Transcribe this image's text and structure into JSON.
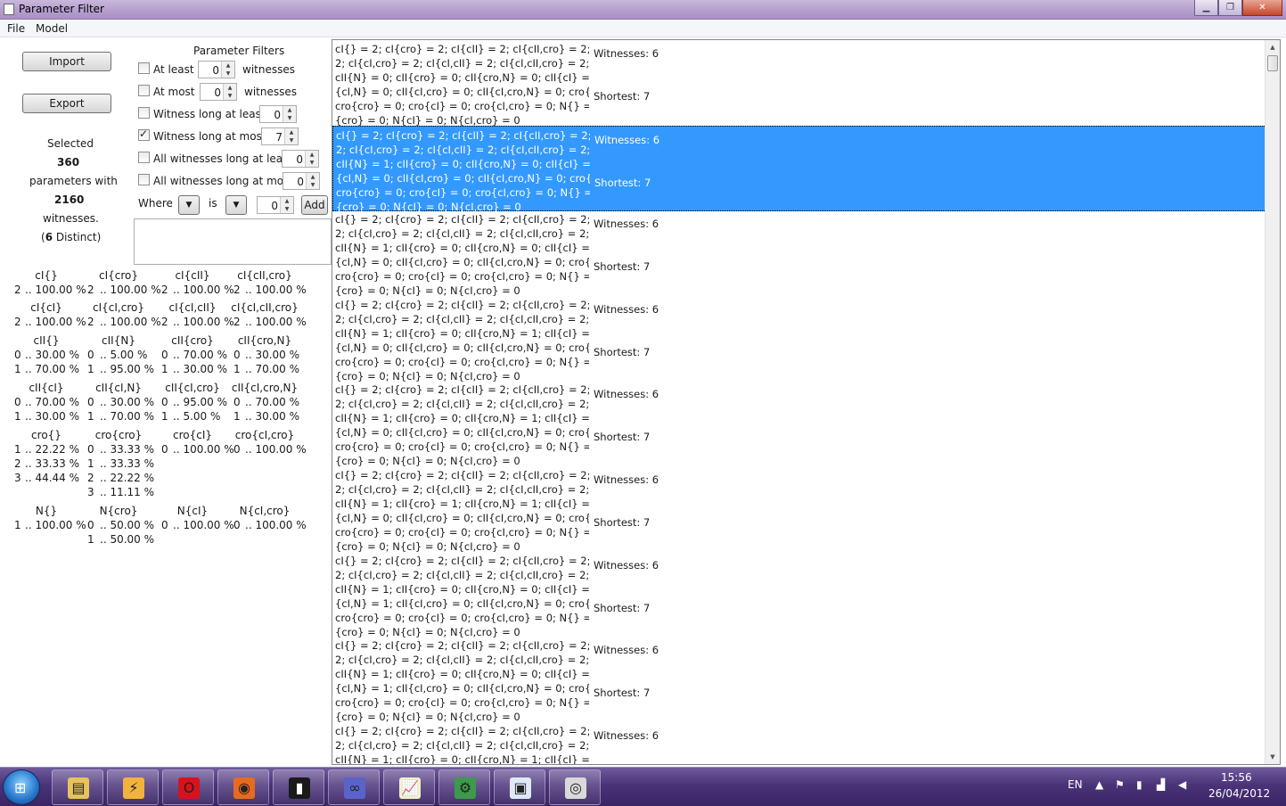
{
  "window": {
    "title": "Parameter Filter"
  },
  "menu": {
    "file": "File",
    "model": "Model"
  },
  "buttons": {
    "import": "Import",
    "export": "Export",
    "add": "Add"
  },
  "filters": {
    "heading": "Parameter Filters",
    "at_least": "At least",
    "at_least_value": "0",
    "at_least_suffix": "witnesses",
    "at_most": "At most",
    "at_most_value": "0",
    "at_most_suffix": "witnesses",
    "witness_long_at_least": "Witness long at least",
    "witness_long_at_least_value": "0",
    "witness_long_at_most": "Witness long at most",
    "witness_long_at_most_value": "7",
    "all_witnesses_long_at_least": "All witnesses long at least",
    "all_witnesses_long_at_least_value": "0",
    "all_witnesses_long_at_most": "All witnesses long at most",
    "all_witnesses_long_at_most_value": "0",
    "where": "Where",
    "is": "is",
    "where_value": "0"
  },
  "summary": {
    "selected": "Selected",
    "count": "360",
    "parameters_with": "parameters with",
    "witnesses": "2160",
    "witnesses_label": "witnesses.",
    "distinct_open": "(",
    "distinct": "6",
    "distinct_close": " Distinct)"
  },
  "stats": [
    [
      {
        "name": "cI{}",
        "rows": [
          [
            "2",
            ".. 100.00 %"
          ]
        ]
      },
      {
        "name": "cI{cro}",
        "rows": [
          [
            "2",
            ".. 100.00 %"
          ]
        ]
      },
      {
        "name": "cI{cII}",
        "rows": [
          [
            "2",
            ".. 100.00 %"
          ]
        ]
      },
      {
        "name": "cI{cII,cro}",
        "rows": [
          [
            "2",
            ".. 100.00 %"
          ]
        ]
      }
    ],
    [
      {
        "name": "cI{cI}",
        "rows": [
          [
            "2",
            ".. 100.00 %"
          ]
        ]
      },
      {
        "name": "cI{cI,cro}",
        "rows": [
          [
            "2",
            ".. 100.00 %"
          ]
        ]
      },
      {
        "name": "cI{cI,cII}",
        "rows": [
          [
            "2",
            ".. 100.00 %"
          ]
        ]
      },
      {
        "name": "cI{cI,cII,cro}",
        "rows": [
          [
            "2",
            ".. 100.00 %"
          ]
        ]
      }
    ],
    [
      {
        "name": "cII{}",
        "rows": [
          [
            "0",
            ".. 30.00 %"
          ],
          [
            "1",
            ".. 70.00 %"
          ]
        ]
      },
      {
        "name": "cII{N}",
        "rows": [
          [
            "0",
            ".. 5.00 %"
          ],
          [
            "1",
            ".. 95.00 %"
          ]
        ]
      },
      {
        "name": "cII{cro}",
        "rows": [
          [
            "0",
            ".. 70.00 %"
          ],
          [
            "1",
            ".. 30.00 %"
          ]
        ]
      },
      {
        "name": "cII{cro,N}",
        "rows": [
          [
            "0",
            ".. 30.00 %"
          ],
          [
            "1",
            ".. 70.00 %"
          ]
        ]
      }
    ],
    [
      {
        "name": "cII{cI}",
        "rows": [
          [
            "0",
            ".. 70.00 %"
          ],
          [
            "1",
            ".. 30.00 %"
          ]
        ]
      },
      {
        "name": "cII{cI,N}",
        "rows": [
          [
            "0",
            ".. 30.00 %"
          ],
          [
            "1",
            ".. 70.00 %"
          ]
        ]
      },
      {
        "name": "cII{cI,cro}",
        "rows": [
          [
            "0",
            ".. 95.00 %"
          ],
          [
            "1",
            ".. 5.00 %"
          ]
        ]
      },
      {
        "name": "cII{cI,cro,N}",
        "rows": [
          [
            "0",
            ".. 70.00 %"
          ],
          [
            "1",
            ".. 30.00 %"
          ]
        ]
      }
    ],
    [
      {
        "name": "cro{}",
        "rows": [
          [
            "1",
            ".. 22.22 %"
          ],
          [
            "2",
            ".. 33.33 %"
          ],
          [
            "3",
            ".. 44.44 %"
          ]
        ]
      },
      {
        "name": "cro{cro}",
        "rows": [
          [
            "0",
            ".. 33.33 %"
          ],
          [
            "1",
            ".. 33.33 %"
          ],
          [
            "2",
            ".. 22.22 %"
          ],
          [
            "3",
            ".. 11.11 %"
          ]
        ]
      },
      {
        "name": "cro{cI}",
        "rows": [
          [
            "0",
            ".. 100.00 %"
          ]
        ]
      },
      {
        "name": "cro{cI,cro}",
        "rows": [
          [
            "0",
            ".. 100.00 %"
          ]
        ]
      }
    ],
    [
      {
        "name": "N{}",
        "rows": [
          [
            "1",
            ".. 100.00 %"
          ]
        ]
      },
      {
        "name": "N{cro}",
        "rows": [
          [
            "0",
            ".. 50.00 %"
          ],
          [
            "1",
            ".. 50.00 %"
          ]
        ]
      },
      {
        "name": "N{cI}",
        "rows": [
          [
            "0",
            ".. 100.00 %"
          ]
        ]
      },
      {
        "name": "N{cI,cro}",
        "rows": [
          [
            "0",
            ".. 100.00 %"
          ]
        ]
      }
    ]
  ],
  "list": {
    "items": [
      {
        "lines": [
          "cI{} = 2; cI{cro} = 2; cI{cII} = 2; cI{cII,cro} = 2; cI{cI} =",
          "2; cI{cI,cro} = 2; cI{cI,cII} = 2; cI{cI,cII,cro} = 2; cII{} = 0;",
          "cII{N} = 0; cII{cro} = 0; cII{cro,N} = 0; cII{cI} = 0; cII",
          "{cI,N} = 0; cII{cI,cro} = 0; cII{cI,cro,N} = 0; cro{} = 1;",
          "cro{cro} = 0; cro{cI} = 0; cro{cI,cro} = 0; N{} = 1; N",
          "{cro} = 0; N{cI} = 0; N{cI,cro} = 0"
        ],
        "witnesses": "Witnesses: 6",
        "shortest": "Shortest: 7"
      },
      {
        "lines": [
          "cI{} = 2; cI{cro} = 2; cI{cII} = 2; cI{cII,cro} = 2; cI{cI} =",
          "2; cI{cI,cro} = 2; cI{cI,cII} = 2; cI{cI,cII,cro} = 2; cII{} = 0;",
          "cII{N} = 1; cII{cro} = 0; cII{cro,N} = 0; cII{cI} = 0; cII",
          "{cI,N} = 0; cII{cI,cro} = 0; cII{cI,cro,N} = 0; cro{} = 1;",
          "cro{cro} = 0; cro{cI} = 0; cro{cI,cro} = 0; N{} = 1; N",
          "{cro} = 0; N{cI} = 0; N{cI,cro} = 0"
        ],
        "witnesses": "Witnesses: 6",
        "shortest": "Shortest: 7"
      },
      {
        "lines": [
          "cI{} = 2; cI{cro} = 2; cI{cII} = 2; cI{cII,cro} = 2; cI{cI} =",
          "2; cI{cI,cro} = 2; cI{cI,cII} = 2; cI{cI,cII,cro} = 2; cII{} = 1;",
          "cII{N} = 1; cII{cro} = 0; cII{cro,N} = 0; cII{cI} = 0; cII",
          "{cI,N} = 0; cII{cI,cro} = 0; cII{cI,cro,N} = 0; cro{} = 1;",
          "cro{cro} = 0; cro{cI} = 0; cro{cI,cro} = 0; N{} = 1; N",
          "{cro} = 0; N{cI} = 0; N{cI,cro} = 0"
        ],
        "witnesses": "Witnesses: 6",
        "shortest": "Shortest: 7"
      },
      {
        "lines": [
          "cI{} = 2; cI{cro} = 2; cI{cII} = 2; cI{cII,cro} = 2; cI{cI} =",
          "2; cI{cI,cro} = 2; cI{cI,cII} = 2; cI{cI,cII,cro} = 2; cII{} = 0;",
          "cII{N} = 1; cII{cro} = 0; cII{cro,N} = 1; cII{cI} = 0; cII",
          "{cI,N} = 0; cII{cI,cro} = 0; cII{cI,cro,N} = 0; cro{} = 1;",
          "cro{cro} = 0; cro{cI} = 0; cro{cI,cro} = 0; N{} = 1; N",
          "{cro} = 0; N{cI} = 0; N{cI,cro} = 0"
        ],
        "witnesses": "Witnesses: 6",
        "shortest": "Shortest: 7"
      },
      {
        "lines": [
          "cI{} = 2; cI{cro} = 2; cI{cII} = 2; cI{cII,cro} = 2; cI{cI} =",
          "2; cI{cI,cro} = 2; cI{cI,cII} = 2; cI{cI,cII,cro} = 2; cII{} = 1;",
          "cII{N} = 1; cII{cro} = 0; cII{cro,N} = 1; cII{cI} = 0; cII",
          "{cI,N} = 0; cII{cI,cro} = 0; cII{cI,cro,N} = 0; cro{} = 1;",
          "cro{cro} = 0; cro{cI} = 0; cro{cI,cro} = 0; N{} = 1; N",
          "{cro} = 0; N{cI} = 0; N{cI,cro} = 0"
        ],
        "witnesses": "Witnesses: 6",
        "shortest": "Shortest: 7"
      },
      {
        "lines": [
          "cI{} = 2; cI{cro} = 2; cI{cII} = 2; cI{cII,cro} = 2; cI{cI} =",
          "2; cI{cI,cro} = 2; cI{cI,cII} = 2; cI{cI,cII,cro} = 2; cII{} = 1;",
          "cII{N} = 1; cII{cro} = 1; cII{cro,N} = 1; cII{cI} = 0; cII",
          "{cI,N} = 0; cII{cI,cro} = 0; cII{cI,cro,N} = 0; cro{} = 1;",
          "cro{cro} = 0; cro{cI} = 0; cro{cI,cro} = 0; N{} = 1; N",
          "{cro} = 0; N{cI} = 0; N{cI,cro} = 0"
        ],
        "witnesses": "Witnesses: 6",
        "shortest": "Shortest: 7"
      },
      {
        "lines": [
          "cI{} = 2; cI{cro} = 2; cI{cII} = 2; cI{cII,cro} = 2; cI{cI} =",
          "2; cI{cI,cro} = 2; cI{cI,cII} = 2; cI{cI,cII,cro} = 2; cII{} = 0;",
          "cII{N} = 1; cII{cro} = 0; cII{cro,N} = 0; cII{cI} = 0; cII",
          "{cI,N} = 1; cII{cI,cro} = 0; cII{cI,cro,N} = 0; cro{} = 1;",
          "cro{cro} = 0; cro{cI} = 0; cro{cI,cro} = 0; N{} = 1; N",
          "{cro} = 0; N{cI} = 0; N{cI,cro} = 0"
        ],
        "witnesses": "Witnesses: 6",
        "shortest": "Shortest: 7"
      },
      {
        "lines": [
          "cI{} = 2; cI{cro} = 2; cI{cII} = 2; cI{cII,cro} = 2; cI{cI} =",
          "2; cI{cI,cro} = 2; cI{cI,cII} = 2; cI{cI,cII,cro} = 2; cII{} = 1;",
          "cII{N} = 1; cII{cro} = 0; cII{cro,N} = 0; cII{cI} = 0; cII",
          "{cI,N} = 1; cII{cI,cro} = 0; cII{cI,cro,N} = 0; cro{} = 1;",
          "cro{cro} = 0; cro{cI} = 0; cro{cI,cro} = 0; N{} = 1; N",
          "{cro} = 0; N{cI} = 0; N{cI,cro} = 0"
        ],
        "witnesses": "Witnesses: 6",
        "shortest": "Shortest: 7"
      },
      {
        "lines": [
          "cI{} = 2; cI{cro} = 2; cI{cII} = 2; cI{cII,cro} = 2; cI{cI} =",
          "2; cI{cI,cro} = 2; cI{cI,cII} = 2; cI{cI,cII,cro} = 2; cII{} = 0;",
          "cII{N} = 1; cII{cro} = 0; cII{cro,N} = 1; cII{cI} = 0; cII"
        ],
        "witnesses": "Witnesses: 6",
        "shortest": ""
      }
    ],
    "selected_index": 1
  },
  "taskbar": {
    "start_glyph": "⊞",
    "apps": [
      {
        "name": "explorer-icon",
        "glyph": "▤",
        "color": "#e8c25a"
      },
      {
        "name": "winamp-icon",
        "glyph": "⚡",
        "color": "#f2b33d"
      },
      {
        "name": "opera-icon",
        "glyph": "O",
        "color": "#d8121c"
      },
      {
        "name": "firefox-icon",
        "glyph": "◉",
        "color": "#e66b1f"
      },
      {
        "name": "terminal-icon",
        "glyph": "▮",
        "color": "#1a1a1a"
      },
      {
        "name": "infinity-icon",
        "glyph": "∞",
        "color": "#5a63c9"
      },
      {
        "name": "chart-app-icon",
        "glyph": "📈",
        "color": "#f3f0c8"
      },
      {
        "name": "tool-icon",
        "glyph": "⚙",
        "color": "#3d9a4b"
      },
      {
        "name": "window-app-icon",
        "glyph": "▣",
        "color": "#dfe9f5"
      },
      {
        "name": "disc-icon",
        "glyph": "◎",
        "color": "#d9d9d9"
      }
    ],
    "lang": "EN",
    "time": "15:56",
    "date": "26/04/2012"
  }
}
